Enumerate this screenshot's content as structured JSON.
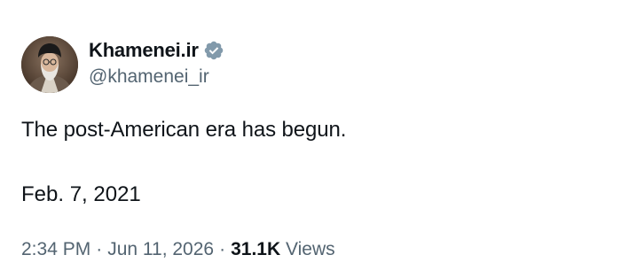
{
  "author": {
    "display_name": "Khamenei.ir",
    "handle": "@khamenei_ir",
    "verified": true,
    "verified_color": "#829aab",
    "avatar": "avatar-portrait"
  },
  "tweet": {
    "text": "The post-American era has begun.",
    "text_line2": "Feb. 7, 2021"
  },
  "meta": {
    "time": "2:34 PM",
    "separator": "·",
    "date": "Jun 11, 2026",
    "views_count": "31.1K",
    "views_label": "Views"
  },
  "colors": {
    "text_primary": "#0f1419",
    "text_secondary": "#536471"
  }
}
